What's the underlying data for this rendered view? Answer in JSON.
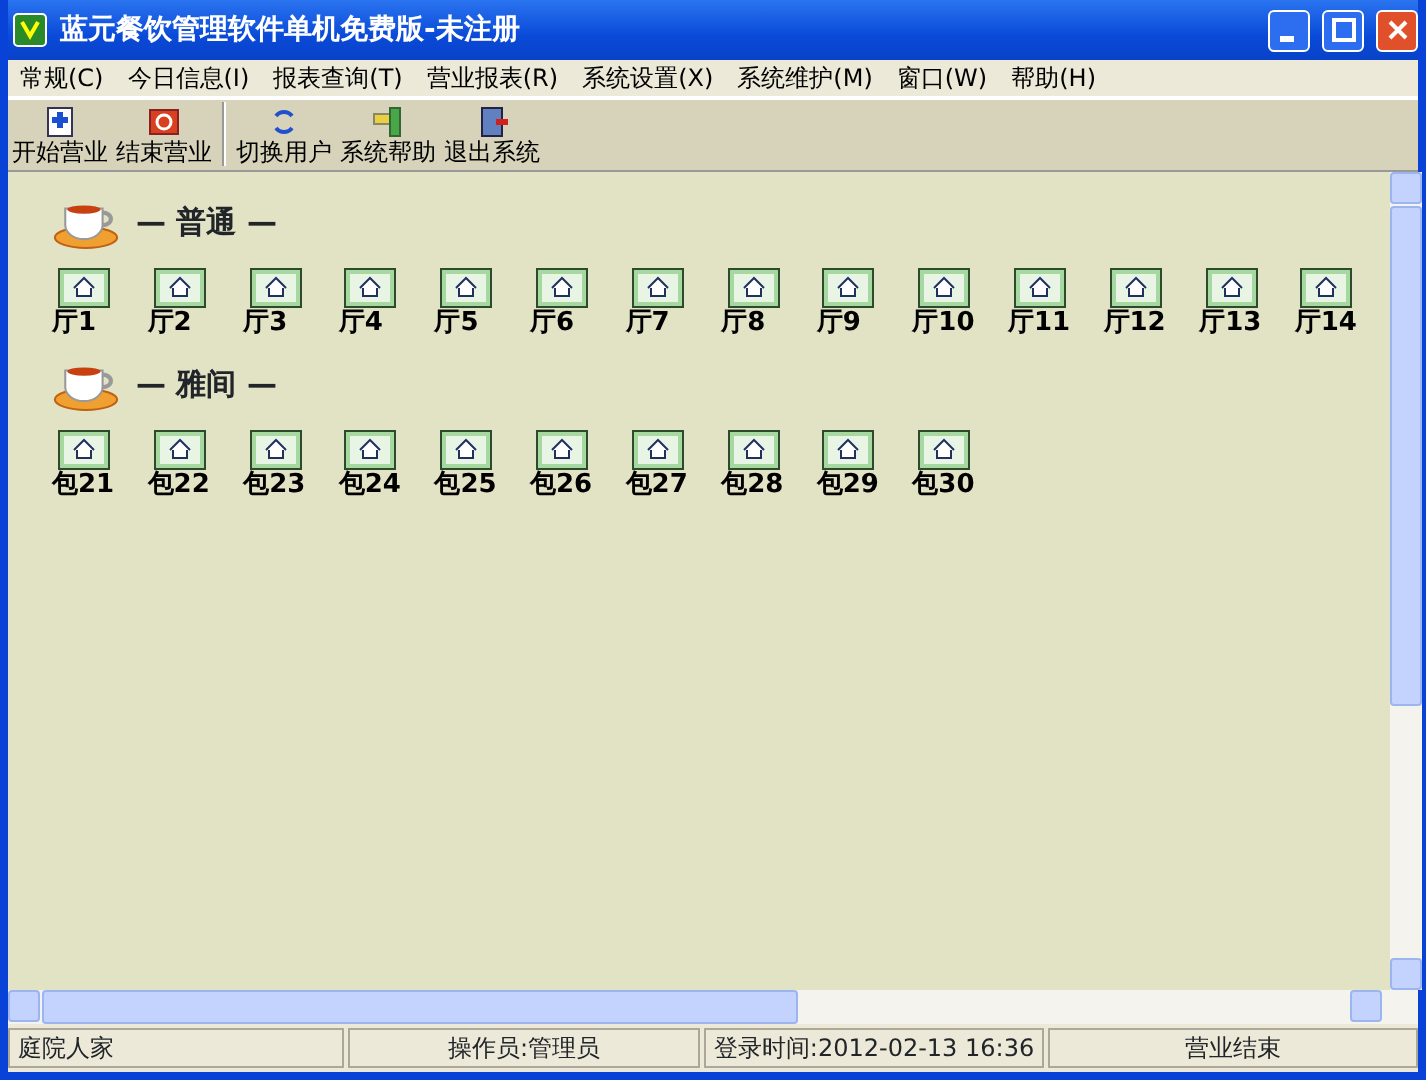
{
  "window": {
    "title": "蓝元餐饮管理软件单机免费版-未注册"
  },
  "menu": [
    "常规(C)",
    "今日信息(I)",
    "报表查询(T)",
    "营业报表(R)",
    "系统设置(X)",
    "系统维护(M)",
    "窗口(W)",
    "帮助(H)"
  ],
  "toolbar": [
    {
      "label": "开始营业",
      "kind": "start"
    },
    {
      "label": "结束营业",
      "kind": "stop"
    },
    {
      "label": "切换用户",
      "kind": "switch"
    },
    {
      "label": "系统帮助",
      "kind": "help"
    },
    {
      "label": "退出系统",
      "kind": "exit"
    }
  ],
  "sections": [
    {
      "title": "— 普通 —",
      "rooms": [
        "厅1",
        "厅2",
        "厅3",
        "厅4",
        "厅5",
        "厅6",
        "厅7",
        "厅8",
        "厅9",
        "厅10",
        "厅11",
        "厅12",
        "厅13",
        "厅14"
      ]
    },
    {
      "title": "— 雅间 —",
      "rooms": [
        "包21",
        "包22",
        "包23",
        "包24",
        "包25",
        "包26",
        "包27",
        "包28",
        "包29",
        "包30"
      ]
    }
  ],
  "status_bar": [
    "庭院人家",
    "操作员:管理员",
    "登录时间:2012-02-13 16:36",
    "营业结束"
  ]
}
